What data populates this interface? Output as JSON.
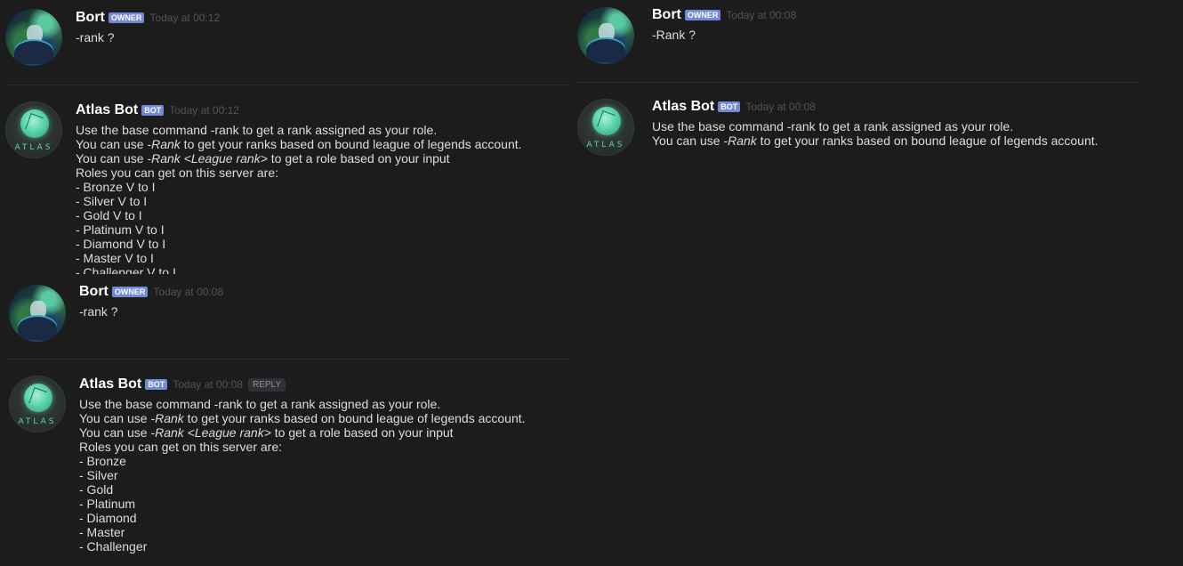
{
  "user": {
    "name": "Bort",
    "badge": "OWNER"
  },
  "bot": {
    "name": "Atlas Bot",
    "badge": "BOT",
    "avatar_text": "ATLAS"
  },
  "panel1": {
    "user_time": "Today at 00:12",
    "user_message": "-rank ?",
    "bot_time": "Today at 00:12",
    "bot_lines": [
      {
        "pre": "Use the base command -rank to get a rank assigned as your role.",
        "em": "",
        "post": ""
      },
      {
        "pre": "You can use -",
        "em": "Rank",
        "post": " to get your ranks based on bound league of legends account."
      },
      {
        "pre": "You can use -",
        "em": "Rank <League rank>",
        "post": " to get a role based on your input"
      },
      {
        "pre": "Roles you can get on this server are:",
        "em": "",
        "post": ""
      },
      {
        "pre": "- Bronze V to I",
        "em": "",
        "post": ""
      },
      {
        "pre": "- Silver V to I",
        "em": "",
        "post": ""
      },
      {
        "pre": "- Gold V to I",
        "em": "",
        "post": ""
      },
      {
        "pre": "- Platinum V to I",
        "em": "",
        "post": ""
      },
      {
        "pre": "- Diamond V to I",
        "em": "",
        "post": ""
      },
      {
        "pre": "- Master V to I",
        "em": "",
        "post": ""
      },
      {
        "pre": "- Challenger V to I",
        "em": "",
        "post": ""
      }
    ]
  },
  "panel2": {
    "user_time": "Today at 00:08",
    "user_message": "-rank ?",
    "bot_time": "Today at 00:08",
    "reply_label": "REPLY",
    "bot_lines": [
      {
        "pre": "Use the base command -rank to get a rank assigned as your role.",
        "em": "",
        "post": ""
      },
      {
        "pre": "You can use -",
        "em": "Rank",
        "post": " to get your ranks based on bound league of legends account."
      },
      {
        "pre": "You can use -",
        "em": "Rank <League rank>",
        "post": " to get a role based on your input"
      },
      {
        "pre": "Roles you can get on this server are:",
        "em": "",
        "post": ""
      },
      {
        "pre": "- Bronze",
        "em": "",
        "post": ""
      },
      {
        "pre": "- Silver",
        "em": "",
        "post": ""
      },
      {
        "pre": "- Gold",
        "em": "",
        "post": ""
      },
      {
        "pre": "- Platinum",
        "em": "",
        "post": ""
      },
      {
        "pre": "- Diamond",
        "em": "",
        "post": ""
      },
      {
        "pre": "- Master",
        "em": "",
        "post": ""
      },
      {
        "pre": "- Challenger",
        "em": "",
        "post": ""
      }
    ]
  },
  "panel3": {
    "user_time": "Today at 00:08",
    "user_message": "-Rank ?",
    "bot_time": "Today at 00:08",
    "bot_lines": [
      {
        "pre": "Use the base command -rank to get a rank assigned as your role.",
        "em": "",
        "post": ""
      },
      {
        "pre": "You can use -",
        "em": "Rank",
        "post": " to get your ranks based on bound league of legends account."
      }
    ]
  }
}
